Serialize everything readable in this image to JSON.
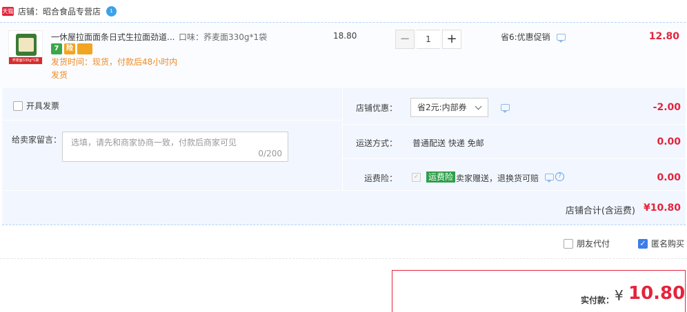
{
  "shop": {
    "badge": "天猫",
    "label": "店铺：",
    "name": "昭合食品专营店",
    "ww_badge": "1"
  },
  "item": {
    "thumb_strip": "荞麦面330g*1袋",
    "title": "一休屋拉面面条日式生拉面劲道...",
    "sku": "口味：荞麦面330g*1袋",
    "services": [
      "7",
      "险",
      ""
    ],
    "ship_time": "发货时间：现货，付款后48小时内发货",
    "unit_price": "18.80",
    "quantity": "1",
    "qty_minus": "−",
    "qty_plus": "+",
    "promo": "省6:优惠促销",
    "total": "12.80"
  },
  "options": {
    "invoice_label": "开具发票",
    "message_label": "给卖家留言：",
    "message_placeholder": "选填，请先和商家协商一致，付款后商家可见",
    "message_count": "0/200",
    "coupon_label": "店铺优惠：",
    "coupon_selected": "省2元:内部券",
    "coupon_amount": "-2.00",
    "shipping_label": "运送方式：",
    "shipping_value": "普通配送 快递 免邮",
    "shipping_amount": "0.00",
    "insurance_label": "运费险：",
    "insurance_badge": "运费险",
    "insurance_text": "卖家赠送，退换货可赔",
    "insurance_amount": "0.00",
    "subtotal_label": "店铺合计(含运费)",
    "subtotal_amount": "¥10.80"
  },
  "payment": {
    "friend_pay_label": "朋友代付",
    "anonymous_label": "匿名购买",
    "total_label": "实付款：",
    "currency": "¥",
    "total_amount": "10.80"
  },
  "colors": {
    "price_red": "#e3243c",
    "accent_blue": "#3d7ee8",
    "panel_bg": "#f2f7ff",
    "ship_orange": "#ef8a24"
  }
}
